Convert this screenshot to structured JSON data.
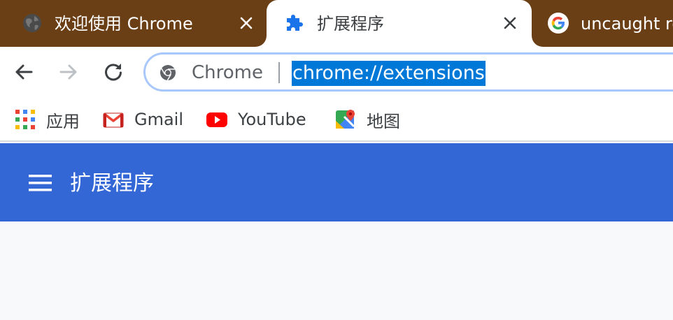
{
  "tabs": [
    {
      "title": "欢迎使用 Chrome",
      "icon": "globe-icon",
      "active": false
    },
    {
      "title": "扩展程序",
      "icon": "puzzle-icon",
      "active": true
    },
    {
      "title": "uncaught re",
      "icon": "google-g-icon",
      "active": false
    }
  ],
  "omnibox": {
    "chip": "Chrome",
    "url": "chrome://extensions",
    "selected": true
  },
  "bookmarks": [
    {
      "label": "应用",
      "icon": "apps-grid-icon"
    },
    {
      "label": "Gmail",
      "icon": "gmail-icon"
    },
    {
      "label": "YouTube",
      "icon": "youtube-icon"
    },
    {
      "label": "地图",
      "icon": "maps-icon"
    }
  ],
  "extensions": {
    "header_title": "扩展程序"
  },
  "colors": {
    "tabstrip": "#6b3f16",
    "header": "#3367d6",
    "selection": "#0078d7",
    "page_bg": "#f8f9fa"
  }
}
